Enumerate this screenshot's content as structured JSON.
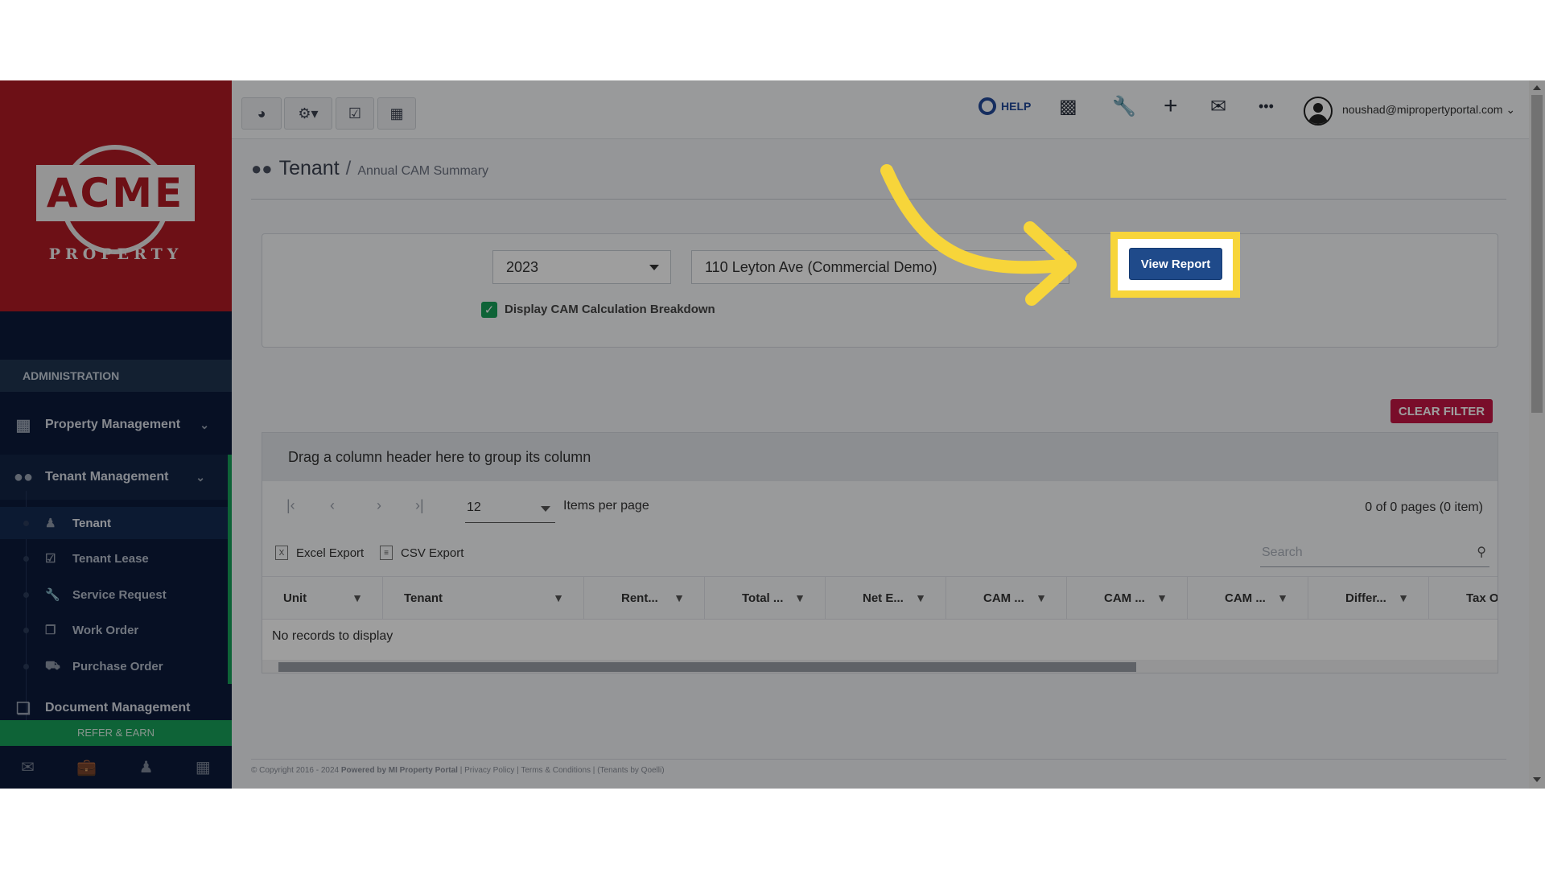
{
  "brand": {
    "logo_text": "ACME",
    "logo_sub": "PROPERTY"
  },
  "sidebar": {
    "section_title": "ADMINISTRATION",
    "items": [
      {
        "label": "Property Management",
        "icon": "building-icon"
      },
      {
        "label": "Tenant Management",
        "icon": "users-icon"
      },
      {
        "label": "Document Management",
        "icon": "documents-icon"
      }
    ],
    "submenu": [
      {
        "label": "Tenant",
        "icon": "user-icon",
        "active": true
      },
      {
        "label": "Tenant Lease",
        "icon": "calendar-check-icon"
      },
      {
        "label": "Service Request",
        "icon": "wrench-icon"
      },
      {
        "label": "Work Order",
        "icon": "copy-icon"
      },
      {
        "label": "Purchase Order",
        "icon": "truck-icon"
      }
    ],
    "refer_label": "REFER & EARN",
    "bottom_icons": [
      "mail-icon",
      "briefcase-icon",
      "user-icon",
      "calculator-icon"
    ]
  },
  "topbar": {
    "left_buttons": [
      "dashboard-icon",
      "settings-icon",
      "calendar-check-icon",
      "calculator-icon"
    ],
    "help_label": "HELP",
    "user_email": "noushad@mipropertyportal.com"
  },
  "breadcrumb": {
    "title": "Tenant",
    "separator": "/",
    "subtitle": "Annual CAM Summary"
  },
  "form": {
    "year_value": "2023",
    "property_value": "110 Leyton Ave (Commercial Demo)",
    "checkbox_label": "Display CAM Calculation Breakdown",
    "checkbox_checked": true,
    "view_report_label": "View Report"
  },
  "grid": {
    "clear_filter_label": "CLEAR FILTER",
    "group_hint": "Drag a column header here to group its column",
    "page_size": "12",
    "items_per_page_label": "Items per page",
    "page_info": "0 of 0 pages (0 item)",
    "excel_export_label": "Excel Export",
    "csv_export_label": "CSV Export",
    "search_placeholder": "Search",
    "columns": [
      "Unit",
      "Tenant",
      "Rent...",
      "Total ...",
      "Net E...",
      "CAM ...",
      "CAM ...",
      "CAM ...",
      "Differ...",
      "Tax O"
    ],
    "empty_message": "No records to display"
  },
  "footer": {
    "copyright": "© Copyright 2016 - 2024",
    "powered": "Powered by MI Property Portal",
    "privacy": "Privacy Policy",
    "terms": "Terms & Conditions",
    "tenants_note": "(Tenants by Qoelli)"
  },
  "colors": {
    "highlight": "#f7d53a",
    "primary": "#1f4a8a",
    "danger": "#c41545",
    "success": "#17a05a",
    "brand_red": "#b11a24"
  }
}
